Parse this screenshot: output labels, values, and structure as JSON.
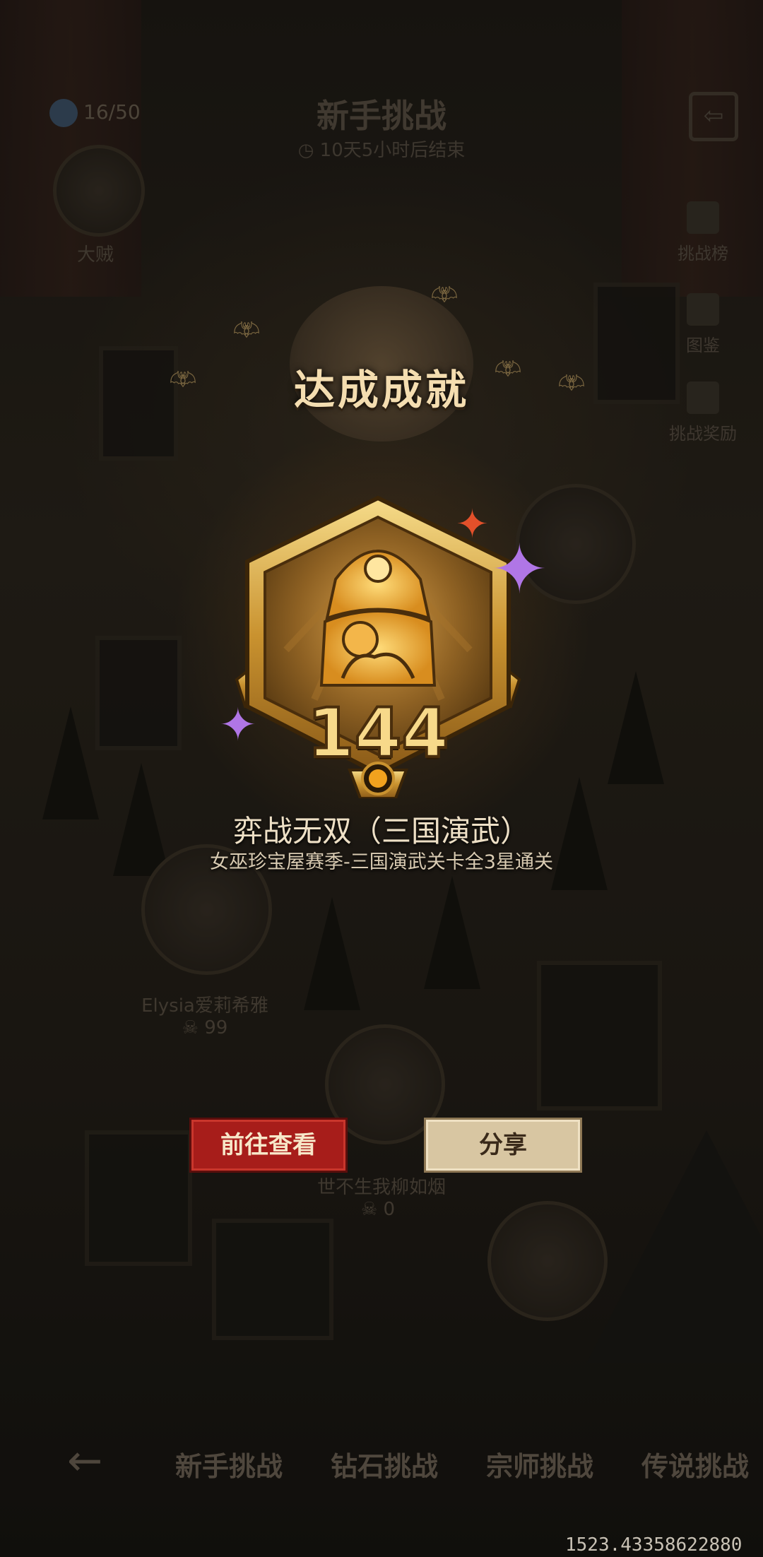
{
  "header": {
    "counter": "16/50",
    "title": "新手挑战",
    "timer": "10天5小时后结束",
    "side_buttons": [
      {
        "label": "挑战榜",
        "icon": "leaderboard-icon"
      },
      {
        "label": "图鉴",
        "icon": "book-icon"
      },
      {
        "label": "挑战奖励",
        "icon": "gift-icon"
      }
    ],
    "exit_icon": "exit-icon"
  },
  "background": {
    "top_avatar_label": "大贼",
    "players": [
      {
        "name": "Elysia爱莉希雅",
        "count": "99"
      },
      {
        "name": "世不生我柳如烟",
        "count": "0"
      }
    ]
  },
  "achievement": {
    "heading": "达成成就",
    "badge_number": "144",
    "name": "弈战无双（三国演武）",
    "description": "女巫珍宝屋赛季-三国演武关卡全3星通关"
  },
  "buttons": {
    "view": "前往查看",
    "share": "分享"
  },
  "bottom_nav": {
    "back_icon": "arrow-left-icon",
    "tabs": [
      "新手挑战",
      "钻石挑战",
      "宗师挑战",
      "传说挑战"
    ]
  },
  "debug_text": "1523.43358622880",
  "colors": {
    "view_button": "#a71d1a",
    "share_button": "#d8c6a2",
    "badge_gold": "#f7d98a",
    "sparkle_purple": "#b076e6"
  }
}
